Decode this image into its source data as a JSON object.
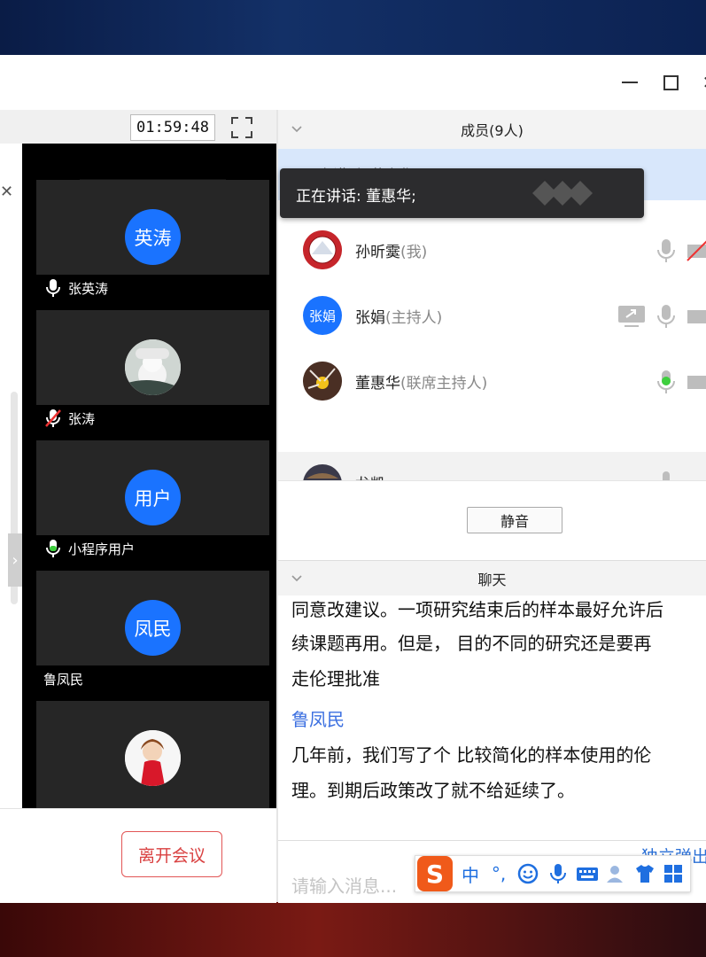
{
  "timer": "01:59:48",
  "left_panel": {
    "close_glyph": "✕",
    "expand_glyph": "›",
    "collapse_glyph": "^",
    "participants": [
      {
        "name": "张英涛",
        "avatar_text": "英涛",
        "mic": "on-white"
      },
      {
        "name": "张涛",
        "avatar_text": "",
        "mic": "muted-red"
      },
      {
        "name": "小程序用户",
        "avatar_text": "用户",
        "mic": "on-green"
      },
      {
        "name": "鲁凤民",
        "avatar_text": "凤民",
        "mic": "none"
      },
      {
        "name": "",
        "avatar_text": "",
        "mic": "on-white"
      }
    ],
    "leave_button": "离开会议"
  },
  "members": {
    "header": "成员(9人)",
    "speaking_prefix": "正在讲话: 董惠华",
    "tooltip": "正在讲话: 董惠华;",
    "list": [
      {
        "name": "孙昕霙",
        "role": "(我)",
        "avatar_text": ""
      },
      {
        "name": "张娟",
        "role": "(主持人)",
        "avatar_text": "张娟"
      },
      {
        "name": "董惠华",
        "role": "(联席主持人)",
        "avatar_text": ""
      }
    ],
    "partial_name": "龙凯",
    "mute_button": "静音"
  },
  "chat": {
    "header": "聊天",
    "lines": [
      "同意改建议。一项研究结束后的样本最好允许后",
      "续课题再用。但是， 目的不同的研究还是要再",
      "走伦理批准"
    ],
    "sender": "鲁凤民",
    "message_lines": [
      "几年前，我们写了个 比较简化的样本使用的伦",
      "理。到期后政策改了就不给延续了。"
    ],
    "popout_link": "独立弹出",
    "input_placeholder": "请输入消息..."
  },
  "ime_toolbar": {
    "logo": "S",
    "items": [
      "中",
      "°,"
    ]
  },
  "colors": {
    "accent": "#1a73ff",
    "leave_red": "#d94040",
    "chat_sender": "#3b6fe0"
  }
}
